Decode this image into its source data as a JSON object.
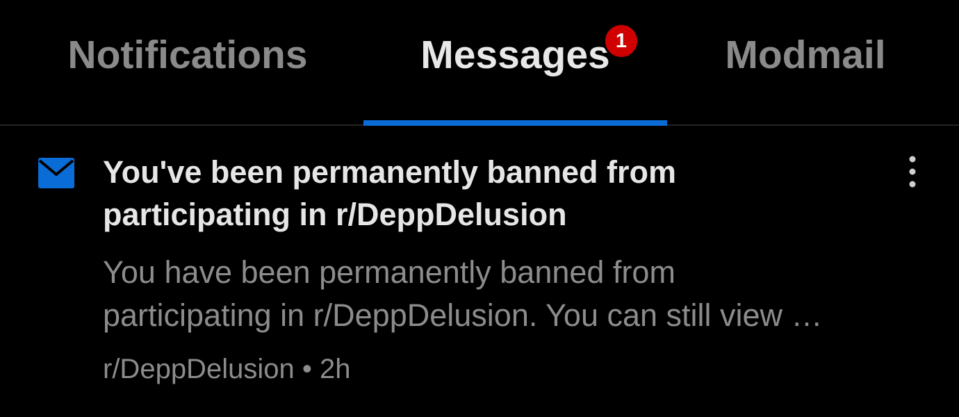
{
  "tabs": {
    "notifications": {
      "label": "Notifications"
    },
    "messages": {
      "label": "Messages",
      "badge": "1"
    },
    "modmail": {
      "label": "Modmail"
    }
  },
  "active_tab": "messages",
  "colors": {
    "accent": "#0a6cd6",
    "badge": "#d10000",
    "background": "#000000"
  },
  "message": {
    "icon": "envelope-icon",
    "unread": true,
    "title": "You've been permanently banned from participating in r/DeppDelusion",
    "preview": "You have been permanently banned from\nparticipating in r/DeppDelusion. You can still view …",
    "subreddit": "r/DeppDelusion",
    "separator": "•",
    "time": "2h",
    "more_icon": "more-vertical-icon"
  }
}
